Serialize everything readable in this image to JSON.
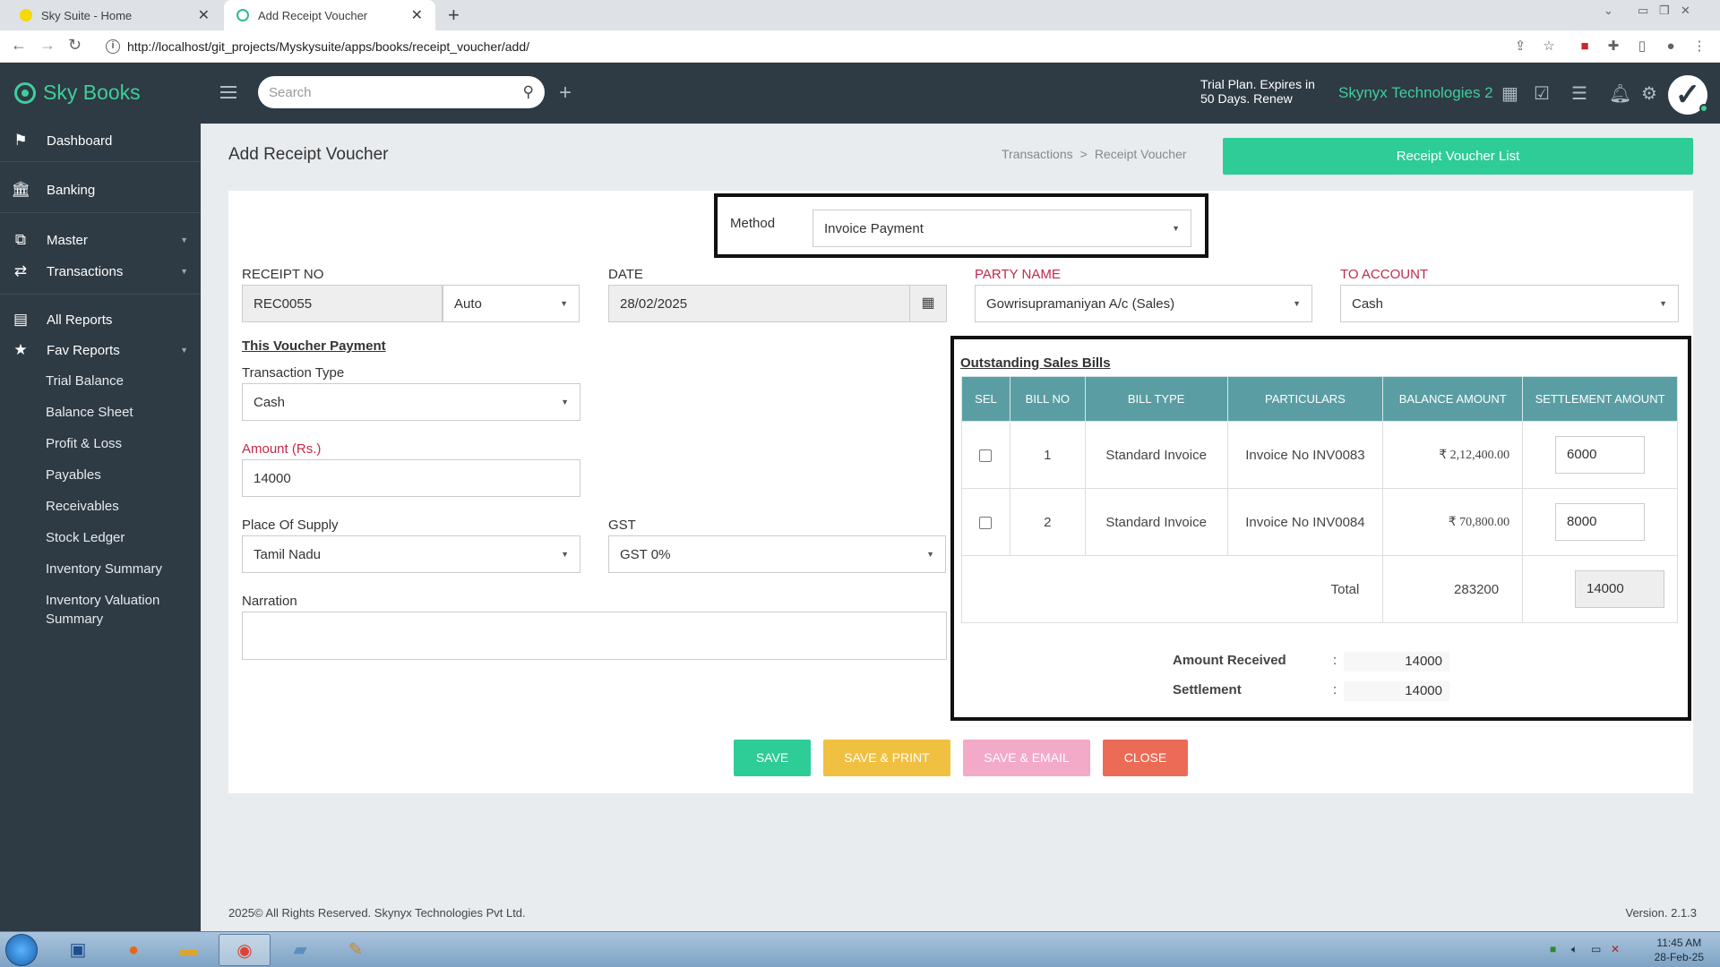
{
  "browser": {
    "tabs": [
      {
        "label": "Sky Suite - Home",
        "active": false
      },
      {
        "label": "Add Receipt Voucher",
        "active": true
      }
    ],
    "url": "http://localhost/git_projects/Myskysuite/apps/books/receipt_voucher/add/"
  },
  "header": {
    "brand": "Sky Books",
    "search_placeholder": "Search",
    "trial_line1": "Trial Plan. Expires in",
    "trial_line2": "50 Days. Renew",
    "company": "Skynyx Technologies 2"
  },
  "sidebar": {
    "dashboard": "Dashboard",
    "banking": "Banking",
    "master": "Master",
    "transactions": "Transactions",
    "all_reports": "All Reports",
    "fav_reports": "Fav Reports",
    "sub_items": [
      "Trial Balance",
      "Balance Sheet",
      "Profit & Loss",
      "Payables",
      "Receivables",
      "Stock Ledger",
      "Inventory Summary",
      "Inventory Valuation",
      "Summary"
    ]
  },
  "page": {
    "title": "Add Receipt Voucher",
    "breadcrumb_1": "Transactions",
    "breadcrumb_sep": ">",
    "breadcrumb_2": "Receipt Voucher",
    "list_button": "Receipt Voucher List"
  },
  "form": {
    "method_label": "Method",
    "method_value": "Invoice Payment",
    "receipt_no_label": "RECEIPT NO",
    "receipt_no_value": "REC0055",
    "receipt_mode": "Auto",
    "date_label": "DATE",
    "date_value": "28/02/2025",
    "party_label": "PARTY NAME",
    "party_value": "Gowrisupramaniyan A/c (Sales)",
    "to_account_label": "TO ACCOUNT",
    "to_account_value": "Cash",
    "this_voucher_label": "This Voucher Payment",
    "transaction_type_label": "Transaction Type",
    "transaction_type_value": "Cash",
    "amount_label": "Amount (Rs.)",
    "amount_value": "14000",
    "place_label": "Place Of Supply",
    "place_value": "Tamil Nadu",
    "gst_label": "GST",
    "gst_value": "GST 0%",
    "narration_label": "Narration",
    "narration_value": ""
  },
  "bills": {
    "title": "Outstanding Sales Bills",
    "headers": [
      "SEL",
      "BILL NO",
      "BILL TYPE",
      "PARTICULARS",
      "BALANCE AMOUNT",
      "SETTLEMENT AMOUNT"
    ],
    "rows": [
      {
        "bill_no": "1",
        "type": "Standard Invoice",
        "particulars": "Invoice No INV0083",
        "balance": "₹ 2,12,400.00",
        "settlement": "6000"
      },
      {
        "bill_no": "2",
        "type": "Standard Invoice",
        "particulars": "Invoice No INV0084",
        "balance": "₹ 70,800.00",
        "settlement": "8000"
      }
    ],
    "total_label": "Total",
    "total_balance": "283200",
    "total_settlement": "14000",
    "amount_received_label": "Amount Received",
    "amount_received_value": "14000",
    "settlement_label": "Settlement",
    "settlement_value": "14000",
    "colon": ":"
  },
  "actions": {
    "save": "SAVE",
    "save_print": "SAVE & PRINT",
    "save_email": "SAVE & EMAIL",
    "close": "CLOSE"
  },
  "footer": {
    "copyright": "2025© All Rights Reserved.",
    "company": "Skynyx Technologies Pvt Ltd.",
    "version": "Version. 2.1.3"
  },
  "taskbar": {
    "time": "11:45 AM",
    "date": "28-Feb-25"
  },
  "colors": {
    "header_bg": "#2e3a44",
    "accent_green": "#2ecc96",
    "table_header": "#5a9ea3",
    "save_print": "#f0c040",
    "save_email": "#f3a9c8",
    "close": "#ec6b56"
  }
}
